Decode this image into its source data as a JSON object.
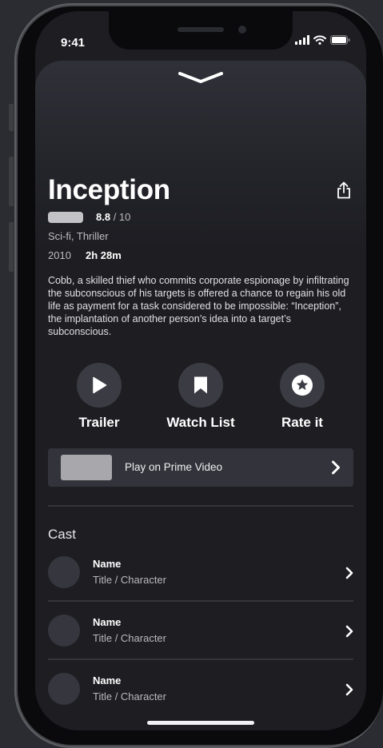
{
  "status_bar": {
    "time": "9:41"
  },
  "movie": {
    "title": "Inception",
    "rating": "8.8",
    "rating_max": "/ 10",
    "genres": "Sci-fi, Thriller",
    "year": "2010",
    "runtime": "2h 28m",
    "synopsis": "Cobb, a skilled thief who commits corporate espionage by infiltrating the subconscious of his targets is offered a chance to regain his old life as payment for a task considered to be impossible: “Inception”, the implantation of another person’s idea into a target’s subconscious."
  },
  "actions": [
    {
      "label": "Trailer",
      "icon": "play-icon"
    },
    {
      "label": "Watch List",
      "icon": "bookmark-icon"
    },
    {
      "label": "Rate it",
      "icon": "star-icon"
    }
  ],
  "streaming": {
    "label": "Play on Prime Video",
    "icon": "chevron-right-icon"
  },
  "cast": {
    "heading": "Cast",
    "members": [
      {
        "name": "Name",
        "role": "Title / Character"
      },
      {
        "name": "Name",
        "role": "Title / Character"
      },
      {
        "name": "Name",
        "role": "Title / Character"
      }
    ]
  },
  "colors": {
    "background": "#1d1d22",
    "card": "#33343b",
    "action_circle": "#3b3c43",
    "text_primary": "#ffffff",
    "text_secondary": "#b9b9be"
  }
}
